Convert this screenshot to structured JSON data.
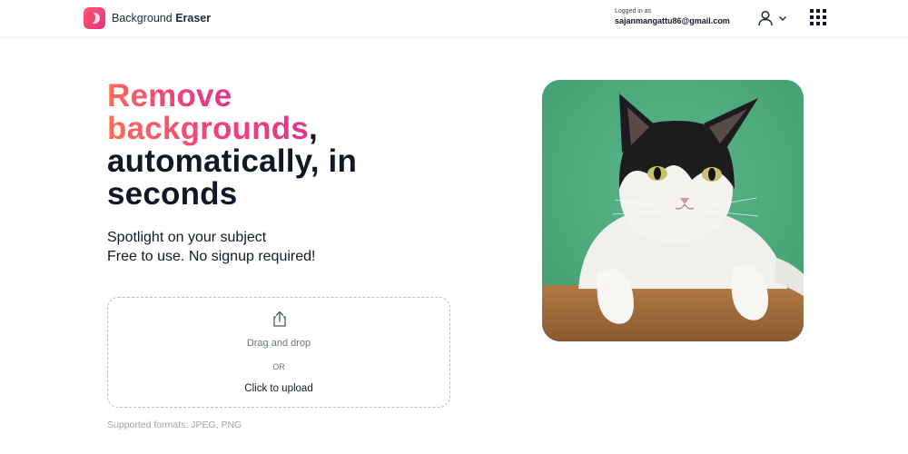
{
  "header": {
    "brand_light": "Background ",
    "brand_bold": "Eraser",
    "logged_label": "Logged in as",
    "email": "sajanmangattu86@gmail.com"
  },
  "hero": {
    "line1": "Remove",
    "line2_accent": "backgrounds",
    "line2_rest": ",",
    "line3": "automatically, in",
    "line4": "seconds",
    "sub1": "Spotlight on your subject",
    "sub2": "Free to use. No signup required!"
  },
  "upload": {
    "drag": "Drag and drop",
    "or": "OR",
    "click": "Click to upload",
    "formats": "Supported formats: JPEG, PNG"
  },
  "icons": {
    "logo": "background-eraser-logo-icon",
    "user": "user-icon",
    "chevron": "chevron-down-icon",
    "apps": "apps-grid-icon",
    "upload": "upload-icon"
  },
  "colors": {
    "accent_start": "#ff6b57",
    "accent_end": "#e0358f",
    "photo_background": "#4eac7f"
  }
}
